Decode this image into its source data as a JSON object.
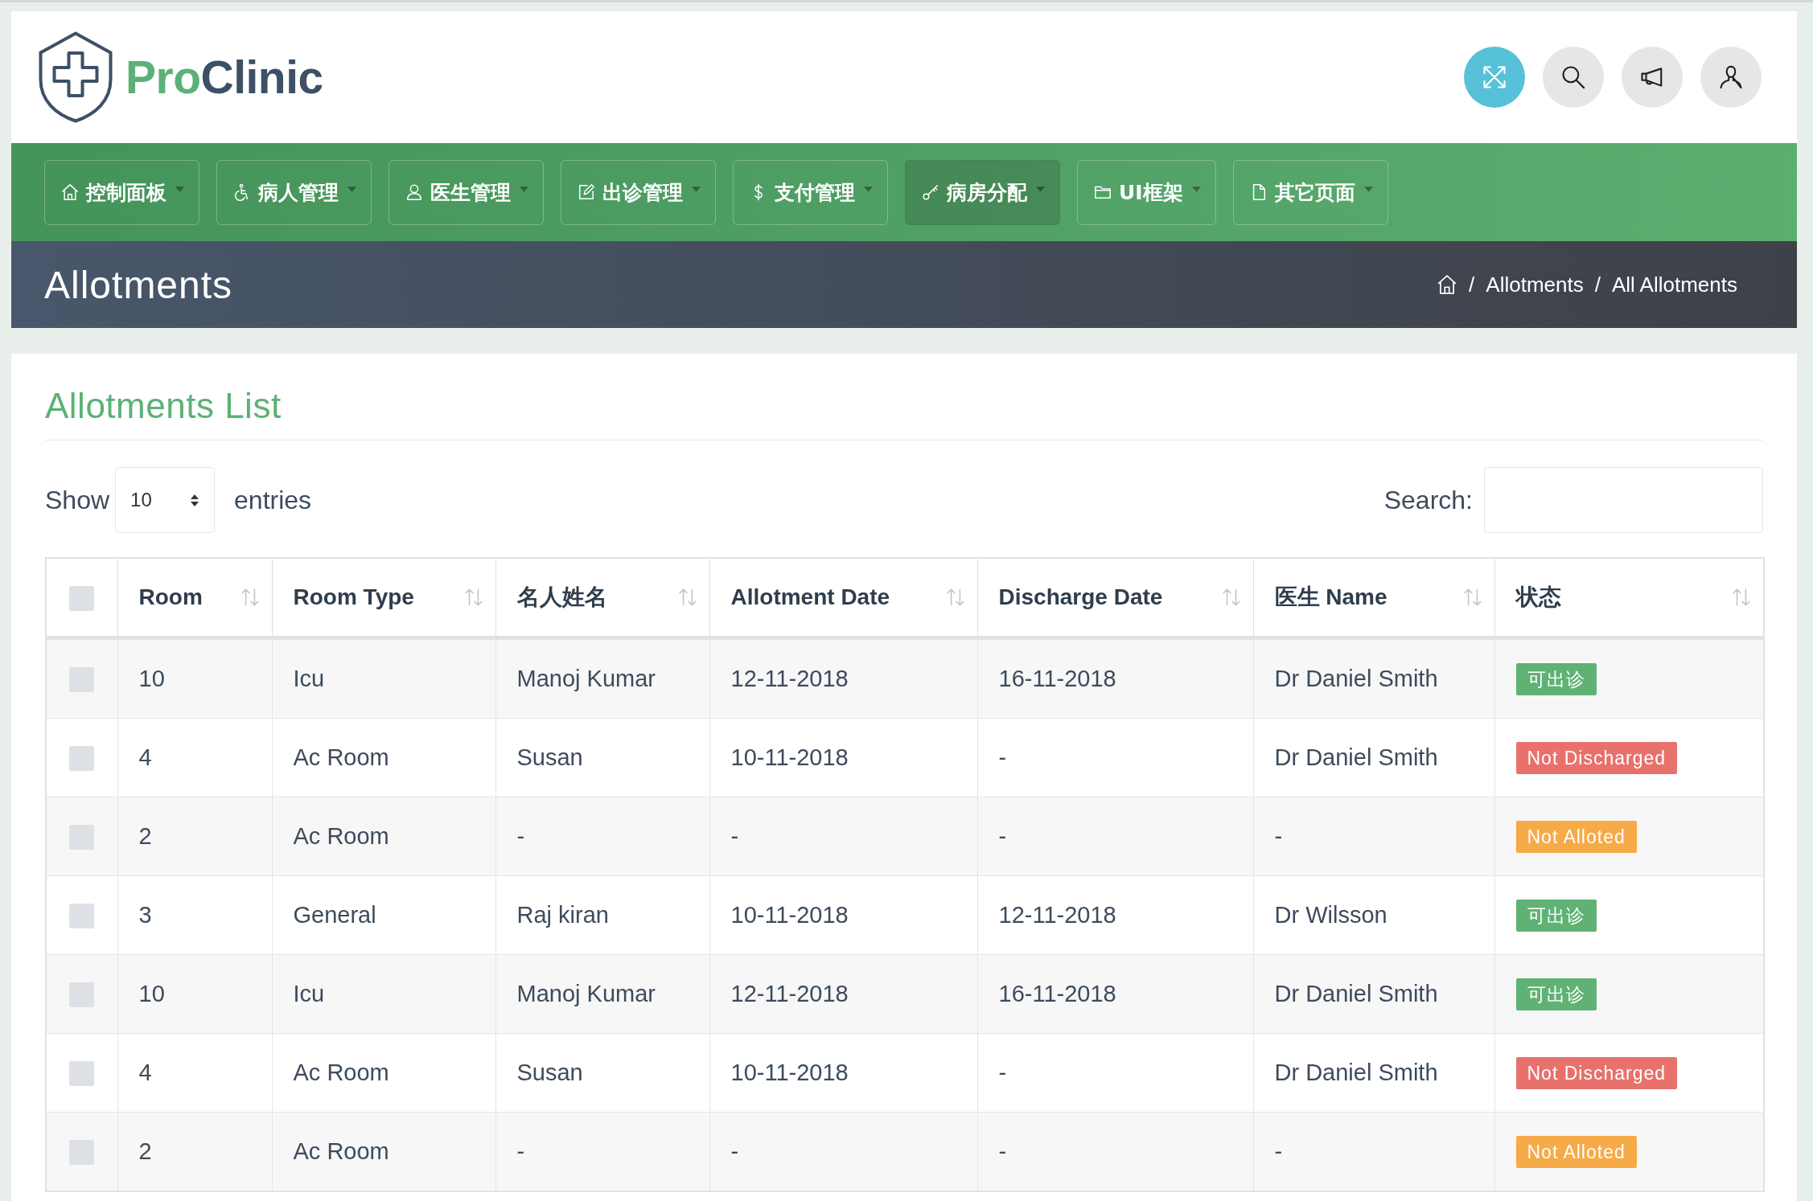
{
  "header": {
    "logo": {
      "first": "Pro",
      "second": "Clinic"
    },
    "buttons": [
      {
        "active": true
      },
      {
        "active": false
      },
      {
        "active": false
      },
      {
        "active": false
      }
    ]
  },
  "nav": [
    {
      "label": "控制面板",
      "selected": false
    },
    {
      "label": "病人管理",
      "selected": false
    },
    {
      "label": "医生管理",
      "selected": false
    },
    {
      "label": "出诊管理",
      "selected": false
    },
    {
      "label": "支付管理",
      "selected": false
    },
    {
      "label": "病房分配",
      "selected": true
    },
    {
      "label": "UI框架",
      "selected": false
    },
    {
      "label": "其它页面",
      "selected": false
    }
  ],
  "page_header": {
    "title": "Allotments",
    "breadcrumb": [
      {
        "separator": "/",
        "label": "Allotments"
      },
      {
        "separator": "/",
        "label": "All Allotments"
      }
    ]
  },
  "card": {
    "title": "Allotments List",
    "length_menu": {
      "label_before": "Show",
      "value": "10",
      "label_after": "entries"
    },
    "search": {
      "label": "Search:"
    }
  },
  "table": {
    "select_all": {
      "checked": false
    },
    "columns": [
      "Room",
      "Room Type",
      "名人姓名",
      "Allotment Date",
      "Discharge Date",
      "医生 Name",
      "状态"
    ],
    "rows": [
      {
        "checked": false,
        "cells": [
          "10",
          "Icu",
          "Manoj Kumar",
          "12-11-2018",
          "16-11-2018",
          "Dr Daniel Smith"
        ],
        "status": {
          "label": "可出诊",
          "color": "#5fb274"
        }
      },
      {
        "checked": false,
        "cells": [
          "4",
          "Ac Room",
          "Susan",
          "10-11-2018",
          "-",
          "Dr Daniel Smith"
        ],
        "status": {
          "label": "Not Discharged",
          "color": "#e8716c"
        }
      },
      {
        "checked": false,
        "cells": [
          "2",
          "Ac Room",
          "-",
          "-",
          "-",
          "-"
        ],
        "status": {
          "label": "Not Alloted",
          "color": "#f6aa48"
        }
      },
      {
        "checked": false,
        "cells": [
          "3",
          "General",
          "Raj kiran",
          "10-11-2018",
          "12-11-2018",
          "Dr Wilsson"
        ],
        "status": {
          "label": "可出诊",
          "color": "#5fb274"
        }
      },
      {
        "checked": false,
        "cells": [
          "10",
          "Icu",
          "Manoj Kumar",
          "12-11-2018",
          "16-11-2018",
          "Dr Daniel Smith"
        ],
        "status": {
          "label": "可出诊",
          "color": "#5fb274"
        }
      },
      {
        "checked": false,
        "cells": [
          "4",
          "Ac Room",
          "Susan",
          "10-11-2018",
          "-",
          "Dr Daniel Smith"
        ],
        "status": {
          "label": "Not Discharged",
          "color": "#e8716c"
        }
      },
      {
        "checked": false,
        "cells": [
          "2",
          "Ac Room",
          "-",
          "-",
          "-",
          "-"
        ],
        "status": {
          "label": "Not Alloted",
          "color": "#f6aa48"
        }
      }
    ]
  }
}
